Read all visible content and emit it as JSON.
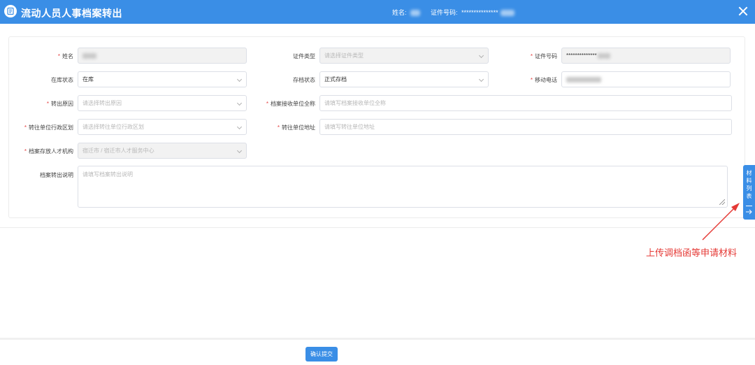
{
  "header": {
    "title": "流动人员人事档案转出",
    "name_label": "姓名:",
    "id_label": "证件号码:",
    "id_value": "***************"
  },
  "form": {
    "name": {
      "label": "姓名",
      "value": ""
    },
    "id_type": {
      "label": "证件类型",
      "placeholder": "请选择证件类型"
    },
    "id_number": {
      "label": "证件号码",
      "value": "**************"
    },
    "storage_status": {
      "label": "在库状态",
      "value": "在库"
    },
    "archive_status": {
      "label": "存档状态",
      "value": "正式存档"
    },
    "mobile": {
      "label": "移动电话",
      "value": ""
    },
    "transfer_reason": {
      "label": "转出原因",
      "placeholder": "请选择转出原因"
    },
    "receiver_name": {
      "label": "档案接收单位全称",
      "placeholder": "请填写档案接收单位全称"
    },
    "dest_region": {
      "label": "转往单位行政区划",
      "placeholder": "请选择转往单位行政区划"
    },
    "dest_address": {
      "label": "转往单位地址",
      "placeholder": "请填写转往单位地址"
    },
    "holding_agency": {
      "label": "档案存放人才机构",
      "value": "宿迁市 / 宿迁市人才服务中心"
    },
    "transfer_note": {
      "label": "档案转出说明",
      "placeholder": "请填写档案转出说明"
    }
  },
  "side_tab": {
    "chars": [
      "材",
      "料",
      "列",
      "表"
    ]
  },
  "annotation": {
    "text": "上传调档函等申请材料",
    "color": "#e53935"
  },
  "footer": {
    "submit_label": "确认提交"
  },
  "colors": {
    "primary": "#3a8ee6",
    "required": "#e54545"
  }
}
